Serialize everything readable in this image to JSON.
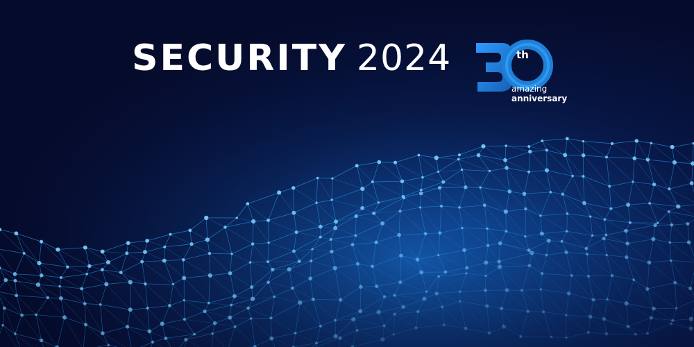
{
  "banner": {
    "title_word": "SECURITY",
    "title_year": "2024",
    "logo": {
      "number": "30",
      "suffix": "th",
      "line1": "amazing",
      "line2": "anniversary"
    }
  },
  "colors": {
    "background": "#050b2b",
    "mesh_blue": "#2aa8ff",
    "logo_blue": "#1e7fd6",
    "text": "#ffffff"
  },
  "decorations": {
    "background_art": "network-mesh-wave"
  }
}
